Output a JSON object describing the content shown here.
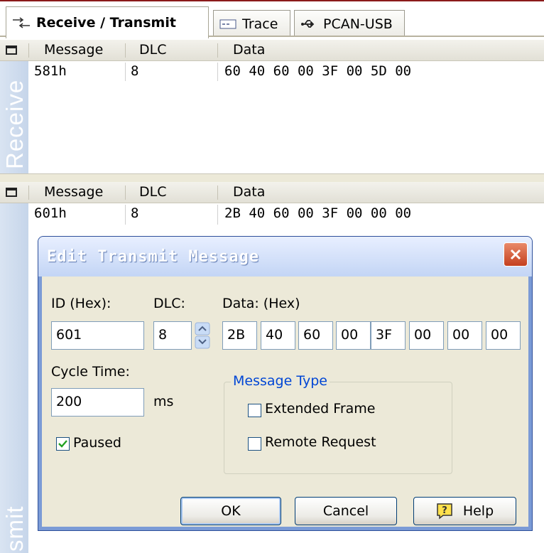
{
  "tabs": [
    {
      "label": "Receive / Transmit",
      "icon": "receive-transmit-icon"
    },
    {
      "label": "Trace",
      "icon": "trace-icon"
    },
    {
      "label": "PCAN-USB",
      "icon": "usb-icon"
    }
  ],
  "receive": {
    "side_label": "Receive",
    "columns": [
      "Message",
      "DLC",
      "Data"
    ],
    "rows": [
      {
        "message": "581h",
        "dlc": "8",
        "data": "60 40 60 00 3F 00 5D 00"
      }
    ]
  },
  "transmit": {
    "side_label": "smit",
    "columns": [
      "Message",
      "DLC",
      "Data"
    ],
    "rows": [
      {
        "message": "601h",
        "dlc": "8",
        "data": "2B 40 60 00 3F 00 00 00"
      }
    ]
  },
  "dialog": {
    "title": "Edit Transmit Message",
    "id_label": "ID (Hex):",
    "id_value": "601",
    "dlc_label": "DLC:",
    "dlc_value": "8",
    "data_label": "Data: (Hex)",
    "data_bytes": [
      "2B",
      "40",
      "60",
      "00",
      "3F",
      "00",
      "00",
      "00"
    ],
    "cycle_label": "Cycle Time:",
    "cycle_value": "200",
    "cycle_unit": "ms",
    "paused_label": "Paused",
    "paused_checked": true,
    "message_type_title": "Message Type",
    "extended_label": "Extended Frame",
    "extended_checked": false,
    "remote_label": "Remote Request",
    "remote_checked": false,
    "ok_label": "OK",
    "cancel_label": "Cancel",
    "help_label": "Help"
  },
  "colors": {
    "accent": "#0046d5",
    "titlebar": "#c3d5f5",
    "close": "#c4401f",
    "dialog_bg": "#ece9d8"
  }
}
